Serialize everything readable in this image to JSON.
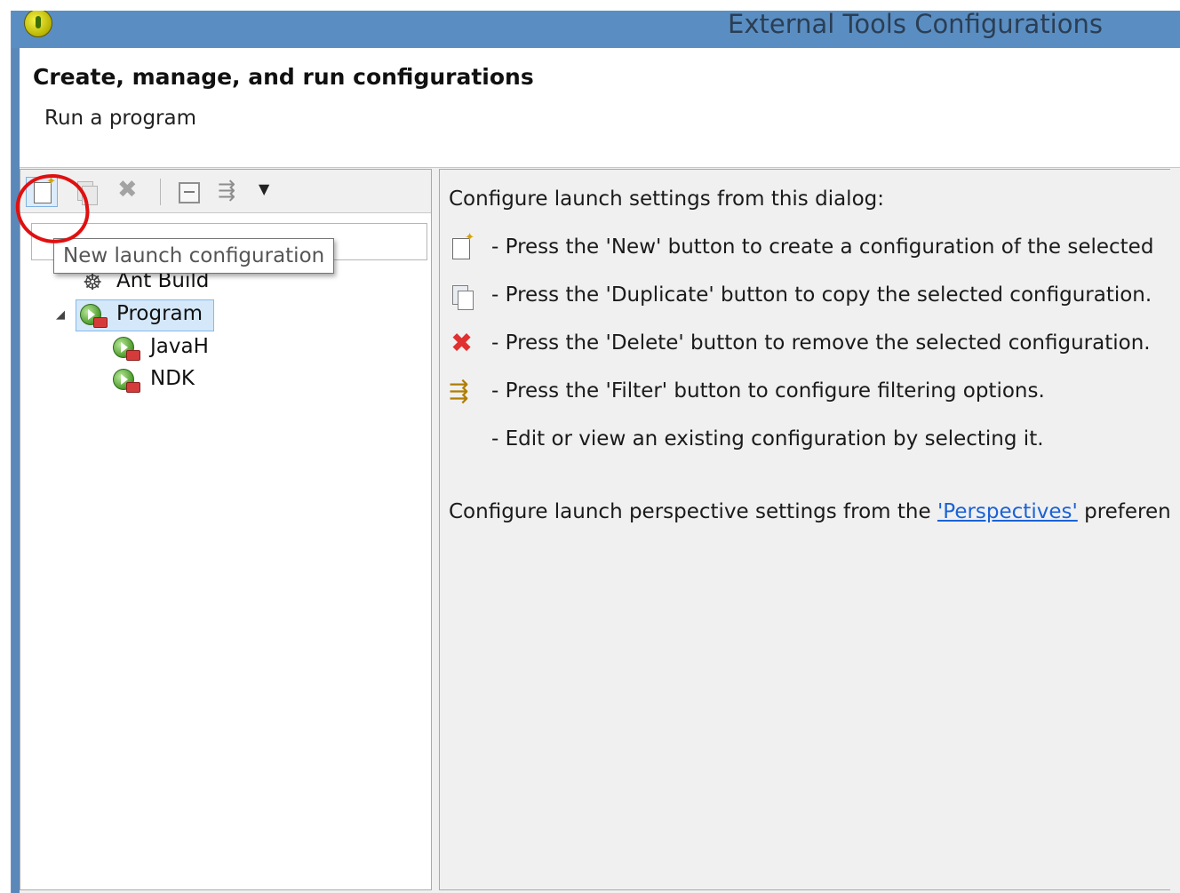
{
  "window": {
    "title": "External Tools Configurations",
    "app_icon": "eclipse-icon"
  },
  "header": {
    "title": "Create, manage, and run configurations",
    "subtitle": "Run a program"
  },
  "toolbar": {
    "buttons": [
      {
        "id": "new",
        "icon": "new-config-icon"
      },
      {
        "id": "duplicate",
        "icon": "duplicate-icon"
      },
      {
        "id": "delete",
        "icon": "delete-icon"
      },
      {
        "id": "collapse",
        "icon": "collapse-all-icon"
      },
      {
        "id": "filter",
        "icon": "filter-icon"
      }
    ],
    "tooltip": "New launch configuration"
  },
  "filter": {
    "value": ""
  },
  "tree": {
    "items": [
      {
        "label": "Ant Build",
        "icon": "ant-icon",
        "level": 1
      },
      {
        "label": "Program",
        "icon": "program-icon",
        "level": 1,
        "expanded": true,
        "selected": true
      },
      {
        "label": "JavaH",
        "icon": "program-icon",
        "level": 2
      },
      {
        "label": "NDK",
        "icon": "program-icon",
        "level": 2
      }
    ]
  },
  "help": {
    "intro": "Configure launch settings from this dialog:",
    "lines": [
      {
        "icon": "new-config-icon",
        "text": "- Press the 'New' button to create a configuration of the selected"
      },
      {
        "icon": "duplicate-icon",
        "text": "- Press the 'Duplicate' button to copy the selected configuration."
      },
      {
        "icon": "delete-icon",
        "text": "- Press the 'Delete' button to remove the selected configuration."
      },
      {
        "icon": "filter-icon",
        "text": "- Press the 'Filter' button to configure filtering options."
      },
      {
        "icon": "",
        "text": "- Edit or view an existing configuration by selecting it."
      }
    ],
    "perspectives_prefix": "Configure launch perspective settings from the ",
    "perspectives_link": "'Perspectives'",
    "perspectives_suffix": " preferen"
  },
  "colors": {
    "titlebar": "#5a8ec2",
    "selection": "#d5e8f9",
    "link": "#1b62d6",
    "annotation": "#e01010"
  }
}
